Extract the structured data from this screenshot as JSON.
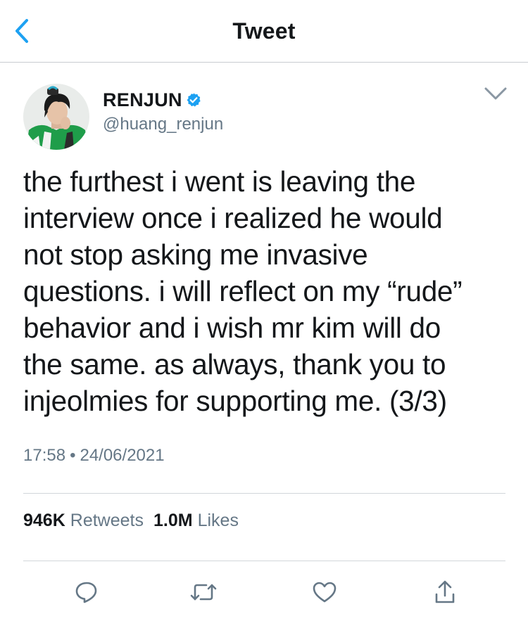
{
  "header": {
    "title": "Tweet",
    "back_icon": "chevron-left-icon"
  },
  "tweet": {
    "display_name": "RENJUN",
    "verified": true,
    "handle": "@huang_renjun",
    "text": "the furthest i went is leaving the\ninterview once i realized he would\nnot stop asking me invasive\nquestions. i will reflect on my “rude”\nbehavior and i wish mr kim will do\nthe same. as always, thank you to\ninjeolmies for supporting me. (3/3)",
    "time": "17:58",
    "separator": "•",
    "date": "24/06/2021"
  },
  "stats": {
    "retweets_count": "946K",
    "retweets_label": "Retweets",
    "likes_count": "1.0M",
    "likes_label": "Likes"
  },
  "actions": [
    "reply-icon",
    "retweet-icon",
    "like-icon",
    "share-icon"
  ],
  "colors": {
    "accent": "#1da1f2",
    "text": "#14171a",
    "secondary": "#657786",
    "divider": "#d2d6da"
  }
}
